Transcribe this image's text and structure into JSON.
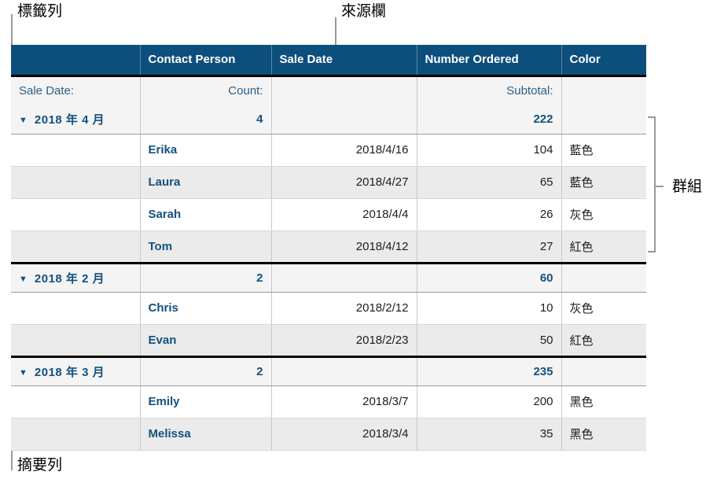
{
  "annotations": {
    "label_column": "標籤列",
    "source_column": "來源欄",
    "group": "群組",
    "summary_row": "摘要列"
  },
  "table": {
    "columns": [
      {
        "key": "label",
        "header": ""
      },
      {
        "key": "contact",
        "header": "Contact Person"
      },
      {
        "key": "date",
        "header": "Sale Date"
      },
      {
        "key": "qty",
        "header": "Number Ordered"
      },
      {
        "key": "color",
        "header": "Color"
      }
    ],
    "summary_legend": {
      "label": "Sale Date:",
      "contact": "Count:",
      "date": "",
      "qty": "Subtotal:",
      "color": ""
    },
    "groups": [
      {
        "label": "2018 年 4 月",
        "count": "4",
        "subtotal": "222",
        "disclosure": "▼",
        "rows": [
          {
            "contact": "Erika",
            "date": "2018/4/16",
            "qty": "104",
            "color": "藍色"
          },
          {
            "contact": "Laura",
            "date": "2018/4/27",
            "qty": "65",
            "color": "藍色"
          },
          {
            "contact": "Sarah",
            "date": "2018/4/4",
            "qty": "26",
            "color": "灰色"
          },
          {
            "contact": "Tom",
            "date": "2018/4/12",
            "qty": "27",
            "color": "紅色"
          }
        ]
      },
      {
        "label": "2018 年 2 月",
        "count": "2",
        "subtotal": "60",
        "disclosure": "▼",
        "rows": [
          {
            "contact": "Chris",
            "date": "2018/2/12",
            "qty": "10",
            "color": "灰色"
          },
          {
            "contact": "Evan",
            "date": "2018/2/23",
            "qty": "50",
            "color": "紅色"
          }
        ]
      },
      {
        "label": "2018 年 3 月",
        "count": "2",
        "subtotal": "235",
        "disclosure": "▼",
        "rows": [
          {
            "contact": "Emily",
            "date": "2018/3/7",
            "qty": "200",
            "color": "黑色"
          },
          {
            "contact": "Melissa",
            "date": "2018/3/4",
            "qty": "35",
            "color": "黑色"
          }
        ]
      }
    ]
  },
  "colors": {
    "header_bg": "#0d4f7c",
    "header_text": "#ffffff",
    "group_text": "#14517e",
    "summary_bg": "#f4f4f4",
    "alt_row_bg": "#ebebeb",
    "leader_line": "#9a9a9a"
  }
}
